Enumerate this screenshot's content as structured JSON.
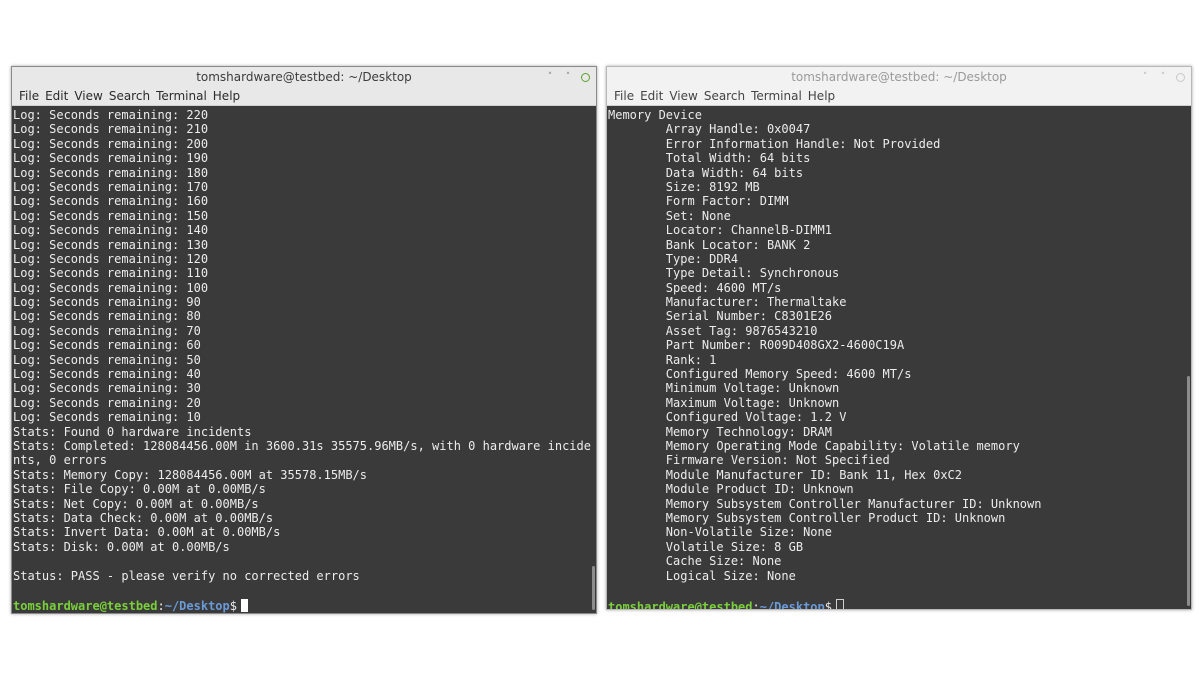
{
  "left_window": {
    "title": "tomshardware@testbed: ~/Desktop",
    "controls": {
      "minimize": "˅",
      "maximize": "˄"
    },
    "menu": [
      "File",
      "Edit",
      "View",
      "Search",
      "Terminal",
      "Help"
    ],
    "lines": [
      "Log: Seconds remaining: 220",
      "Log: Seconds remaining: 210",
      "Log: Seconds remaining: 200",
      "Log: Seconds remaining: 190",
      "Log: Seconds remaining: 180",
      "Log: Seconds remaining: 170",
      "Log: Seconds remaining: 160",
      "Log: Seconds remaining: 150",
      "Log: Seconds remaining: 140",
      "Log: Seconds remaining: 130",
      "Log: Seconds remaining: 120",
      "Log: Seconds remaining: 110",
      "Log: Seconds remaining: 100",
      "Log: Seconds remaining: 90",
      "Log: Seconds remaining: 80",
      "Log: Seconds remaining: 70",
      "Log: Seconds remaining: 60",
      "Log: Seconds remaining: 50",
      "Log: Seconds remaining: 40",
      "Log: Seconds remaining: 30",
      "Log: Seconds remaining: 20",
      "Log: Seconds remaining: 10",
      "Stats: Found 0 hardware incidents",
      "Stats: Completed: 128084456.00M in 3600.31s 35575.96MB/s, with 0 hardware incide",
      "nts, 0 errors",
      "Stats: Memory Copy: 128084456.00M at 35578.15MB/s",
      "Stats: File Copy: 0.00M at 0.00MB/s",
      "Stats: Net Copy: 0.00M at 0.00MB/s",
      "Stats: Data Check: 0.00M at 0.00MB/s",
      "Stats: Invert Data: 0.00M at 0.00MB/s",
      "Stats: Disk: 0.00M at 0.00MB/s",
      "",
      "Status: PASS - please verify no corrected errors",
      ""
    ],
    "prompt": {
      "user": "tomshardware@testbed",
      "sep": ":",
      "path": "~/Desktop",
      "symbol": "$"
    }
  },
  "right_window": {
    "title": "tomshardware@testbed: ~/Desktop",
    "controls": {
      "minimize": "˅",
      "maximize": "˄"
    },
    "menu": [
      "File",
      "Edit",
      "View",
      "Search",
      "Terminal",
      "Help"
    ],
    "lines": [
      "Memory Device",
      "\tArray Handle: 0x0047",
      "\tError Information Handle: Not Provided",
      "\tTotal Width: 64 bits",
      "\tData Width: 64 bits",
      "\tSize: 8192 MB",
      "\tForm Factor: DIMM",
      "\tSet: None",
      "\tLocator: ChannelB-DIMM1",
      "\tBank Locator: BANK 2",
      "\tType: DDR4",
      "\tType Detail: Synchronous",
      "\tSpeed: 4600 MT/s",
      "\tManufacturer: Thermaltake",
      "\tSerial Number: C8301E26",
      "\tAsset Tag: 9876543210",
      "\tPart Number: R009D408GX2-4600C19A",
      "\tRank: 1",
      "\tConfigured Memory Speed: 4600 MT/s",
      "\tMinimum Voltage: Unknown",
      "\tMaximum Voltage: Unknown",
      "\tConfigured Voltage: 1.2 V",
      "\tMemory Technology: DRAM",
      "\tMemory Operating Mode Capability: Volatile memory",
      "\tFirmware Version: Not Specified",
      "\tModule Manufacturer ID: Bank 11, Hex 0xC2",
      "\tModule Product ID: Unknown",
      "\tMemory Subsystem Controller Manufacturer ID: Unknown",
      "\tMemory Subsystem Controller Product ID: Unknown",
      "\tNon-Volatile Size: None",
      "\tVolatile Size: 8 GB",
      "\tCache Size: None",
      "\tLogical Size: None",
      ""
    ],
    "prompt": {
      "user": "tomshardware@testbed",
      "sep": ":",
      "path": "~/Desktop",
      "symbol": "$"
    }
  },
  "colors": {
    "terminal_bg": "#3a3a3a",
    "terminal_fg": "#ececec",
    "prompt_user": "#7ad03a",
    "prompt_path": "#6a9ad8"
  }
}
